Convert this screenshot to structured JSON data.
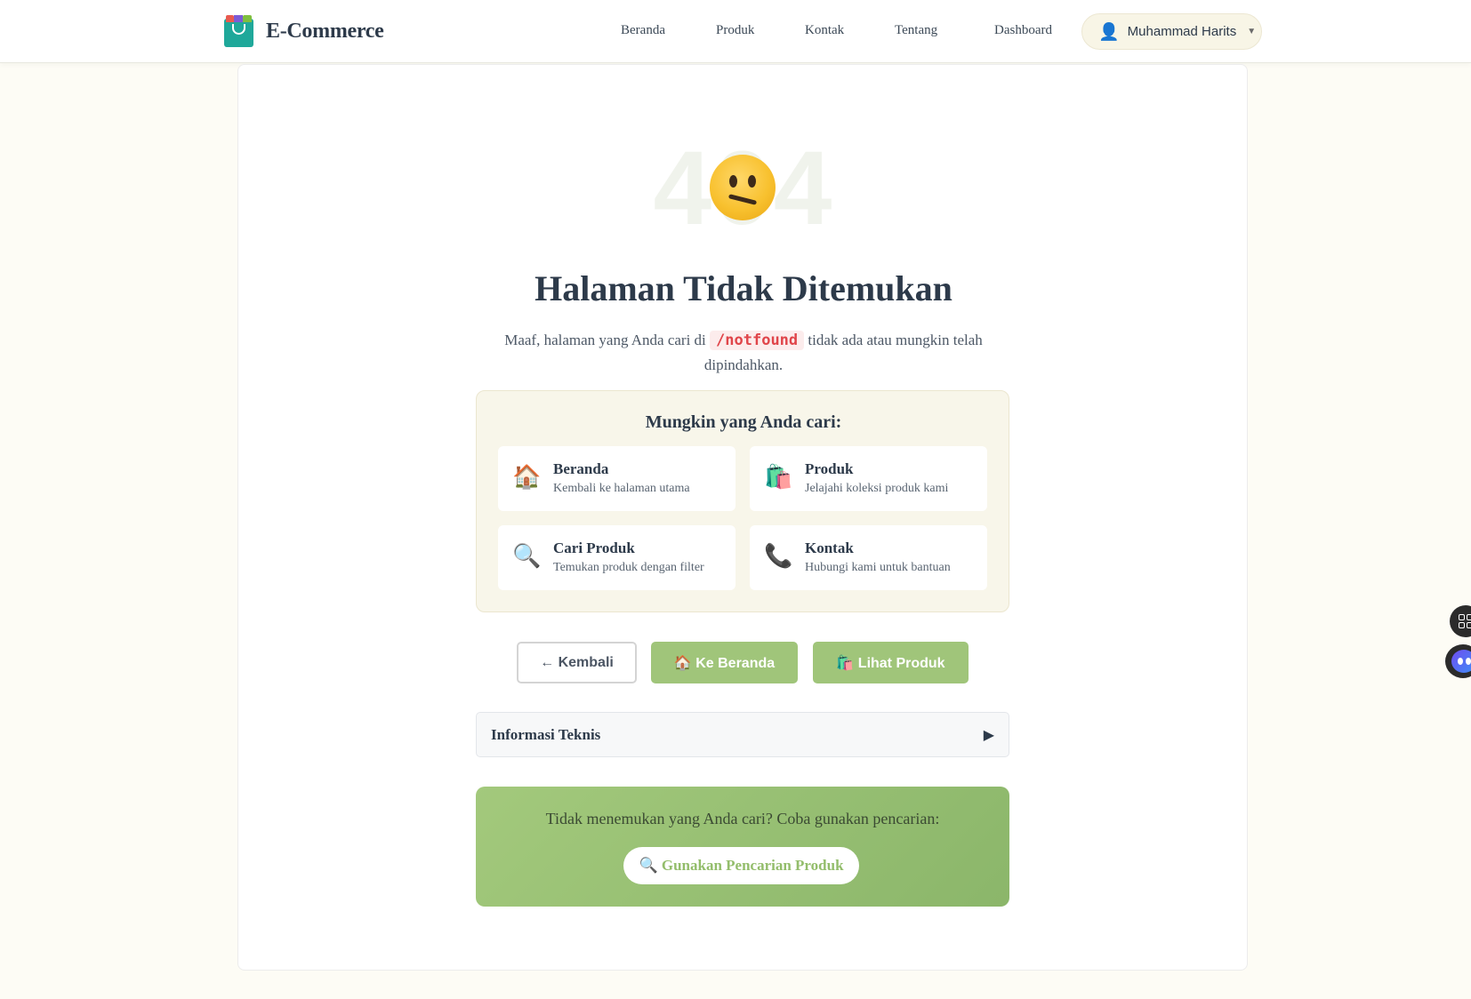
{
  "navbar": {
    "brand": "E-Commerce",
    "links": [
      "Beranda",
      "Produk",
      "Kontak",
      "Tentang",
      "Dashboard"
    ],
    "user": {
      "name": "Muhammad Harits",
      "icon": "user-icon",
      "caret": "▼"
    }
  },
  "error": {
    "code": "404",
    "emoji": "confused-face-icon",
    "title": "Halaman Tidak Ditemukan",
    "message_before": "Maaf, halaman yang Anda cari di",
    "path": "/notfound",
    "message_after": "tidak ada atau mungkin telah dipindahkan."
  },
  "suggestions": {
    "heading": "Mungkin yang Anda cari:",
    "items": [
      {
        "icon": "🏠",
        "title": "Beranda",
        "desc": "Kembali ke halaman utama"
      },
      {
        "icon": "🛍️",
        "title": "Produk",
        "desc": "Jelajahi koleksi produk kami"
      },
      {
        "icon": "🔍",
        "title": "Cari Produk",
        "desc": "Temukan produk dengan filter"
      },
      {
        "icon": "📞",
        "title": "Kontak",
        "desc": "Hubungi kami untuk bantuan"
      }
    ]
  },
  "actions": {
    "back": "← Kembali",
    "home": "🏠 Ke Beranda",
    "products": "🛍️ Lihat Produk"
  },
  "technical": {
    "label": "Informasi Teknis",
    "arrow": "▶"
  },
  "search_cta": {
    "text": "Tidak menemukan yang Anda cari? Coba gunakan pencarian:",
    "button": "🔍 Gunakan Pencarian Produk"
  },
  "colors": {
    "accent_green": "#a0c57a",
    "page_bg": "#fdfcf5",
    "error_path": "#e0454a",
    "heading": "#2d3a4a"
  }
}
